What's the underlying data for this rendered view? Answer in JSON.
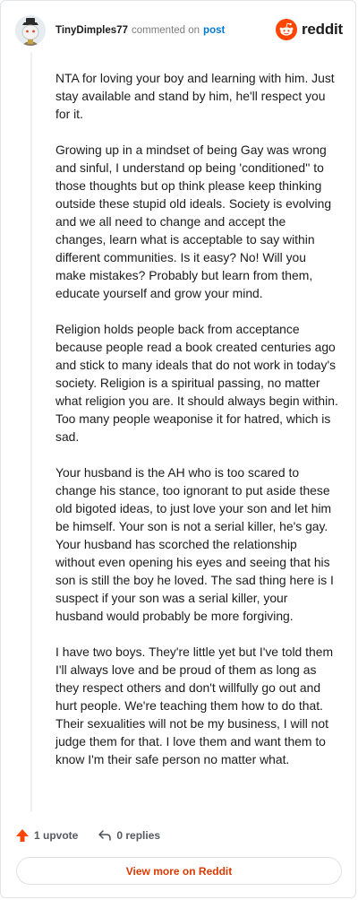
{
  "comment": {
    "username": "TinyDimples77",
    "commented_text": "commented on",
    "post_link": "post",
    "brand": "reddit",
    "paragraphs": [
      "NTA for loving your boy and learning with him. Just stay available and stand by him, he'll respect you for it.",
      "Growing up in a mindset of being Gay was wrong and sinful, I understand op being 'conditioned'' to those thoughts but op think please keep thinking outside these stupid old ideals. Society is evolving and we all need to change and accept the changes, learn what is acceptable to say within different communities. Is it easy? No! Will you make mistakes? Probably but learn from them, educate yourself and grow your mind.",
      "Religion holds people back from acceptance because people read a book created centuries ago and stick to many ideals that do not work in today's society. Religion is a spiritual passing, no matter what religion you are. It should always begin within. Too many people weaponise it for hatred, which is sad.",
      "Your husband is the AH who is too scared to change his stance, too ignorant to put aside these old bigoted ideas, to just love your son and let him be himself. Your son is not a serial killer, he's gay. Your husband has scorched the relationship without even opening his eyes and seeing that his son is still the boy he loved. The sad thing here is I suspect if your son was a serial killer, your husband would probably be more forgiving.",
      "I have two boys. They're little yet but I've told them I'll always love and be proud of them as long as they respect others and don't willfully go out and hurt people. We're teaching them how to do that. Their sexualities will not be my business, I will not judge them for that. I love them and want them to know I'm their safe person no matter what."
    ]
  },
  "footer": {
    "upvote_label": "1 upvote",
    "replies_label": "0 replies",
    "view_more_label": "View more on Reddit"
  },
  "colors": {
    "accent": "#ff4500",
    "link": "#0079d3",
    "view_more_text": "#d93a00"
  },
  "icons": {
    "avatar": "user-avatar",
    "logo": "reddit-snoo-icon",
    "upvote": "upvote-arrow-icon",
    "reply": "reply-arrow-icon"
  }
}
